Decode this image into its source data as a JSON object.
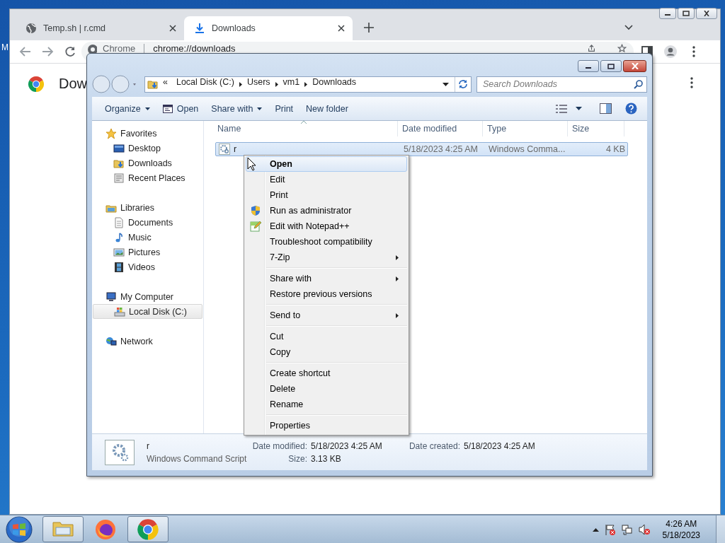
{
  "desktop": {
    "label": "M"
  },
  "browser": {
    "tabs": [
      {
        "title": "Temp.sh | r.cmd",
        "selected": false
      },
      {
        "title": "Downloads",
        "selected": true
      }
    ],
    "omnibox": {
      "site_label": "Chrome",
      "url": "chrome://downloads"
    },
    "page_title": "Dow"
  },
  "explorer": {
    "address": {
      "overflow": "«",
      "path": [
        "Local Disk (C:)",
        "Users",
        "vm1",
        "Downloads"
      ]
    },
    "search": {
      "placeholder": "Search Downloads"
    },
    "commands": [
      {
        "label": "Organize",
        "kind": "dropdown"
      },
      {
        "label": "Open",
        "kind": "icon"
      },
      {
        "label": "Share with",
        "kind": "dropdown"
      },
      {
        "label": "Print",
        "kind": "plain"
      },
      {
        "label": "New folder",
        "kind": "plain"
      }
    ],
    "nav": [
      {
        "label": "Favorites",
        "selected": false,
        "children": [
          {
            "label": "Desktop",
            "selected": false
          },
          {
            "label": "Downloads",
            "selected": false
          },
          {
            "label": "Recent Places",
            "selected": false
          }
        ]
      },
      {
        "label": "Libraries",
        "selected": false,
        "children": [
          {
            "label": "Documents",
            "selected": false
          },
          {
            "label": "Music",
            "selected": false
          },
          {
            "label": "Pictures",
            "selected": false
          },
          {
            "label": "Videos",
            "selected": false
          }
        ]
      },
      {
        "label": "My Computer",
        "selected": false,
        "children": [
          {
            "label": "Local Disk (C:)",
            "selected": true
          }
        ]
      },
      {
        "label": "Network",
        "selected": false
      }
    ],
    "columns": [
      "Name",
      "Date modified",
      "Type",
      "Size"
    ],
    "files": [
      {
        "name": "r",
        "date_modified": "5/18/2023 4:25 AM",
        "type": "Windows Comma...",
        "size": "4 KB",
        "selected": true
      }
    ],
    "details": {
      "name": "r",
      "type": "Windows Command Script",
      "fields": [
        {
          "label": "Date modified:",
          "value": "5/18/2023 4:25 AM"
        },
        {
          "label": "Date created:",
          "value": "5/18/2023 4:25 AM"
        },
        {
          "label": "Size:",
          "value": "3.13 KB"
        }
      ]
    }
  },
  "context_menu": {
    "groups": [
      [
        {
          "label": "Open",
          "default": true,
          "highlighted": true,
          "submenu": false
        },
        {
          "label": "Edit",
          "default": false,
          "highlighted": false,
          "submenu": false
        },
        {
          "label": "Print",
          "default": false,
          "highlighted": false,
          "submenu": false
        },
        {
          "label": "Run as administrator",
          "default": false,
          "highlighted": false,
          "submenu": false
        },
        {
          "label": "Edit with Notepad++",
          "default": false,
          "highlighted": false,
          "submenu": false
        },
        {
          "label": "Troubleshoot compatibility",
          "default": false,
          "highlighted": false,
          "submenu": false
        },
        {
          "label": "7-Zip",
          "default": false,
          "highlighted": false,
          "submenu": true
        }
      ],
      [
        {
          "label": "Share with",
          "default": false,
          "highlighted": false,
          "submenu": true
        },
        {
          "label": "Restore previous versions",
          "default": false,
          "highlighted": false,
          "submenu": false
        }
      ],
      [
        {
          "label": "Send to",
          "default": false,
          "highlighted": false,
          "submenu": true
        }
      ],
      [
        {
          "label": "Cut",
          "default": false,
          "highlighted": false,
          "submenu": false
        },
        {
          "label": "Copy",
          "default": false,
          "highlighted": false,
          "submenu": false
        }
      ],
      [
        {
          "label": "Create shortcut",
          "default": false,
          "highlighted": false,
          "submenu": false
        },
        {
          "label": "Delete",
          "default": false,
          "highlighted": false,
          "submenu": false
        },
        {
          "label": "Rename",
          "default": false,
          "highlighted": false,
          "submenu": false
        }
      ],
      [
        {
          "label": "Properties",
          "default": false,
          "highlighted": false,
          "submenu": false
        }
      ]
    ]
  },
  "taskbar": {
    "apps": [
      {
        "kind": "explorer",
        "running": true
      },
      {
        "kind": "firefox",
        "running": false
      },
      {
        "kind": "chrome",
        "running": true
      }
    ],
    "clock": {
      "time": "4:26 AM",
      "date": "5/18/2023"
    }
  }
}
